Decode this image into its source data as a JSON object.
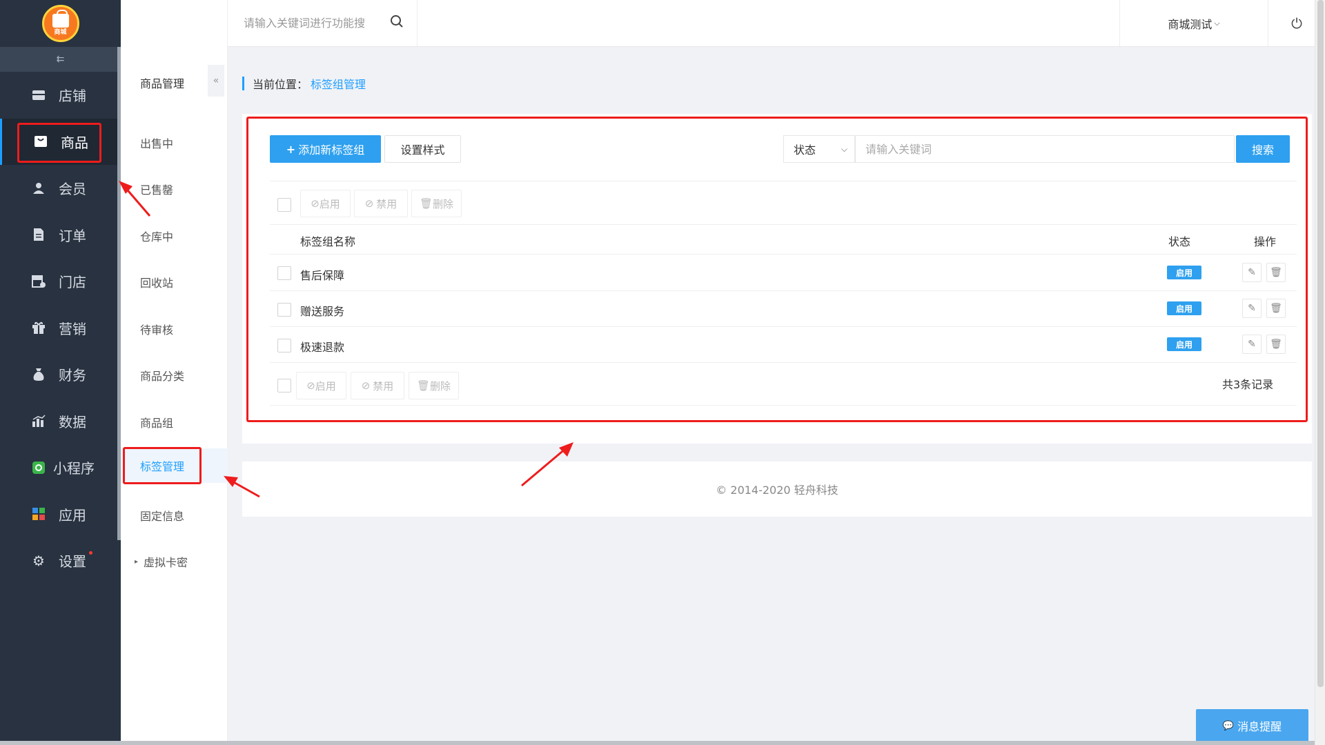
{
  "logo": {
    "text": "商城"
  },
  "sidebar": {
    "collapse_icon": "collapse-left-icon",
    "items": [
      {
        "label": "店铺",
        "icon": "store-icon"
      },
      {
        "label": "商品",
        "icon": "bag-icon",
        "active": true
      },
      {
        "label": "会员",
        "icon": "user-icon"
      },
      {
        "label": "订单",
        "icon": "document-icon"
      },
      {
        "label": "门店",
        "icon": "shop-icon"
      },
      {
        "label": "营销",
        "icon": "gift-icon"
      },
      {
        "label": "财务",
        "icon": "money-bag-icon"
      },
      {
        "label": "数据",
        "icon": "bar-chart-icon"
      },
      {
        "label": "小程序",
        "icon": "miniprogram-icon"
      },
      {
        "label": "应用",
        "icon": "apps-icon"
      },
      {
        "label": "设置",
        "icon": "gear-icon",
        "dot": true
      }
    ]
  },
  "submenu": {
    "title": "商品管理",
    "fold_icon": "double-chevron-left-icon",
    "items": [
      {
        "label": "出售中"
      },
      {
        "label": "已售罄"
      },
      {
        "label": "仓库中"
      },
      {
        "label": "回收站"
      },
      {
        "label": "待审核"
      },
      {
        "label": "商品分类"
      },
      {
        "label": "商品组"
      },
      {
        "label": "标签管理",
        "active": true
      },
      {
        "label": "固定信息"
      },
      {
        "label": "虚拟卡密",
        "expandable": true
      }
    ]
  },
  "topbar": {
    "search_placeholder": "请输入关键词进行功能搜",
    "user": "商城测试",
    "home_icon": "home-icon",
    "menu_icon": "hamburger-icon",
    "search_icon": "search-icon",
    "power_icon": "power-icon"
  },
  "breadcrumb": {
    "prefix": "当前位置：",
    "current": "标签组管理"
  },
  "toolbar": {
    "add_label": "添加新标签组",
    "style_label": "设置样式",
    "status_select": "状态",
    "keyword_placeholder": "请输入关键词",
    "search_label": "搜索"
  },
  "bulk": {
    "enable": "启用",
    "disable": "禁用",
    "delete": "删除"
  },
  "table": {
    "headers": {
      "name": "标签组名称",
      "status": "状态",
      "ops": "操作"
    },
    "rows": [
      {
        "name": "售后保障",
        "status": "启用"
      },
      {
        "name": "赠送服务",
        "status": "启用"
      },
      {
        "name": "极速退款",
        "status": "启用"
      }
    ],
    "total": "共3条记录"
  },
  "footer": {
    "copyright": "© 2014-2020 轻舟科技"
  },
  "message_button": {
    "label": "消息提醒"
  },
  "colors": {
    "accent": "#2ea0ef",
    "sidebar_bg": "#283240",
    "highlight": "#ee1c1c"
  }
}
